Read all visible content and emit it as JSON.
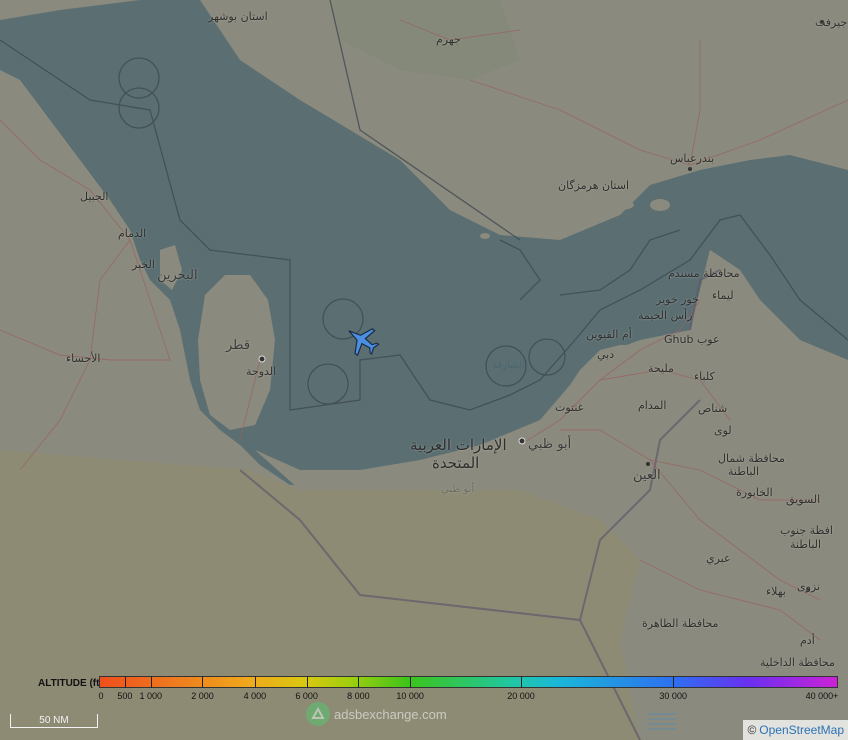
{
  "map": {
    "labels": [
      {
        "id": "bushehr",
        "text": "استان بوشهر",
        "x": 0,
        "y": 0,
        "cls": ""
      },
      {
        "id": "jahrom",
        "text": "جهرم",
        "x": 0,
        "y": 0,
        "cls": ""
      },
      {
        "id": "jiroft",
        "text": "جیرفت",
        "x": 0,
        "y": 0,
        "cls": ""
      },
      {
        "id": "bandar-abbas",
        "text": "بندرعباس",
        "x": 0,
        "y": 0,
        "cls": ""
      },
      {
        "id": "hormozgan",
        "text": "استان هرمزگان",
        "x": 0,
        "y": 0,
        "cls": ""
      },
      {
        "id": "jubail",
        "text": "الجبيل",
        "x": 0,
        "y": 0,
        "cls": ""
      },
      {
        "id": "dammam",
        "text": "الدمام",
        "x": 0,
        "y": 0,
        "cls": ""
      },
      {
        "id": "khobar",
        "text": "الخبر",
        "x": 0,
        "y": 0,
        "cls": ""
      },
      {
        "id": "bahrain",
        "text": "البحرين",
        "x": 0,
        "y": 0,
        "cls": "country"
      },
      {
        "id": "ahsa",
        "text": "الأحساء",
        "x": 0,
        "y": 0,
        "cls": ""
      },
      {
        "id": "qatar",
        "text": "قطر",
        "x": 0,
        "y": 0,
        "cls": "country"
      },
      {
        "id": "doha",
        "text": "الدوحة",
        "x": 0,
        "y": 0,
        "cls": ""
      },
      {
        "id": "musandam",
        "text": "محافظة مسندم",
        "x": 0,
        "y": 0,
        "cls": ""
      },
      {
        "id": "khor-fakkan",
        "text": "خور خوير",
        "x": 0,
        "y": 0,
        "cls": ""
      },
      {
        "id": "lima",
        "text": "ليماء",
        "x": 0,
        "y": 0,
        "cls": ""
      },
      {
        "id": "ras-al-khaimah",
        "text": "رأس الخيمة",
        "x": 0,
        "y": 0,
        "cls": ""
      },
      {
        "id": "umm-al-quwain",
        "text": "أم القيوين",
        "x": 0,
        "y": 0,
        "cls": ""
      },
      {
        "id": "ghub",
        "text": "Ghub عوب",
        "x": 0,
        "y": 0,
        "cls": ""
      },
      {
        "id": "sharjah",
        "text": "الشارقة",
        "x": 0,
        "y": 0,
        "cls": "sea"
      },
      {
        "id": "dubai",
        "text": "دبي",
        "x": 0,
        "y": 0,
        "cls": ""
      },
      {
        "id": "mleiha",
        "text": "مليحة",
        "x": 0,
        "y": 0,
        "cls": ""
      },
      {
        "id": "kalba",
        "text": "كلباء",
        "x": 0,
        "y": 0,
        "cls": ""
      },
      {
        "id": "madam",
        "text": "المدام",
        "x": 0,
        "y": 0,
        "cls": ""
      },
      {
        "id": "shinas",
        "text": "شناص",
        "x": 0,
        "y": 0,
        "cls": ""
      },
      {
        "id": "ghantoot",
        "text": "غنتوت",
        "x": 0,
        "y": 0,
        "cls": ""
      },
      {
        "id": "uae",
        "text": "الإمارات العربية",
        "x": 0,
        "y": 0,
        "cls": "big"
      },
      {
        "id": "uae2",
        "text": "المتحدة",
        "x": 0,
        "y": 0,
        "cls": "big"
      },
      {
        "id": "abu-dhabi",
        "text": "أبو ظبي",
        "x": 0,
        "y": 0,
        "cls": "country"
      },
      {
        "id": "abu-dhabi-2",
        "text": "أبو ظبي",
        "x": 0,
        "y": 0,
        "cls": "faint"
      },
      {
        "id": "liwa",
        "text": "لوى",
        "x": 0,
        "y": 0,
        "cls": ""
      },
      {
        "id": "al-ain",
        "text": "العين",
        "x": 0,
        "y": 0,
        "cls": "country"
      },
      {
        "id": "north-batinah",
        "text": "محافظة شمال",
        "x": 0,
        "y": 0,
        "cls": ""
      },
      {
        "id": "north-batinah-2",
        "text": "الباطنة",
        "x": 0,
        "y": 0,
        "cls": ""
      },
      {
        "id": "khabourah",
        "text": "الخابورة",
        "x": 0,
        "y": 0,
        "cls": ""
      },
      {
        "id": "suwaiq",
        "text": "السويق",
        "x": 0,
        "y": 0,
        "cls": ""
      },
      {
        "id": "south-batinah",
        "text": "افظة جنوب",
        "x": 0,
        "y": 0,
        "cls": ""
      },
      {
        "id": "south-batinah-2",
        "text": "الباطنة",
        "x": 0,
        "y": 0,
        "cls": ""
      },
      {
        "id": "ibri",
        "text": "عبري",
        "x": 0,
        "y": 0,
        "cls": ""
      },
      {
        "id": "nizwa",
        "text": "نزوى",
        "x": 0,
        "y": 0,
        "cls": ""
      },
      {
        "id": "bahla",
        "text": "بهلاء",
        "x": 0,
        "y": 0,
        "cls": ""
      },
      {
        "id": "dhahirah",
        "text": "محافظة الظاهرة",
        "x": 0,
        "y": 0,
        "cls": ""
      },
      {
        "id": "adam",
        "text": "أدم",
        "x": 0,
        "y": 0,
        "cls": ""
      },
      {
        "id": "dakhiliyah",
        "text": "محافظة الداخلية",
        "x": 0,
        "y": 0,
        "cls": ""
      }
    ]
  },
  "altitude_legend": {
    "title": "ALTITUDE (ft)",
    "ticks": [
      {
        "label": "0",
        "pos": 0
      },
      {
        "label": "500",
        "pos": 500
      },
      {
        "label": "1 000",
        "pos": 1000
      },
      {
        "label": "2 000",
        "pos": 2000
      },
      {
        "label": "4 000",
        "pos": 4000
      },
      {
        "label": "6 000",
        "pos": 6000
      },
      {
        "label": "8 000",
        "pos": 8000
      },
      {
        "label": "10 000",
        "pos": 10000
      },
      {
        "label": "20 000",
        "pos": 20000
      },
      {
        "label": "30 000",
        "pos": 30000
      },
      {
        "label": "40 000+",
        "pos": 40000
      }
    ]
  },
  "scale_bar": {
    "label": "50 NM"
  },
  "brand": {
    "text": "adsbexchange.com"
  },
  "attribution": {
    "prefix": "©",
    "link_text": "OpenStreetMap"
  },
  "colors": {
    "water": "#5b6f73",
    "land": "#8b8a7e",
    "desert": "#8f8a72",
    "aircraft": "#4a8fe0"
  }
}
